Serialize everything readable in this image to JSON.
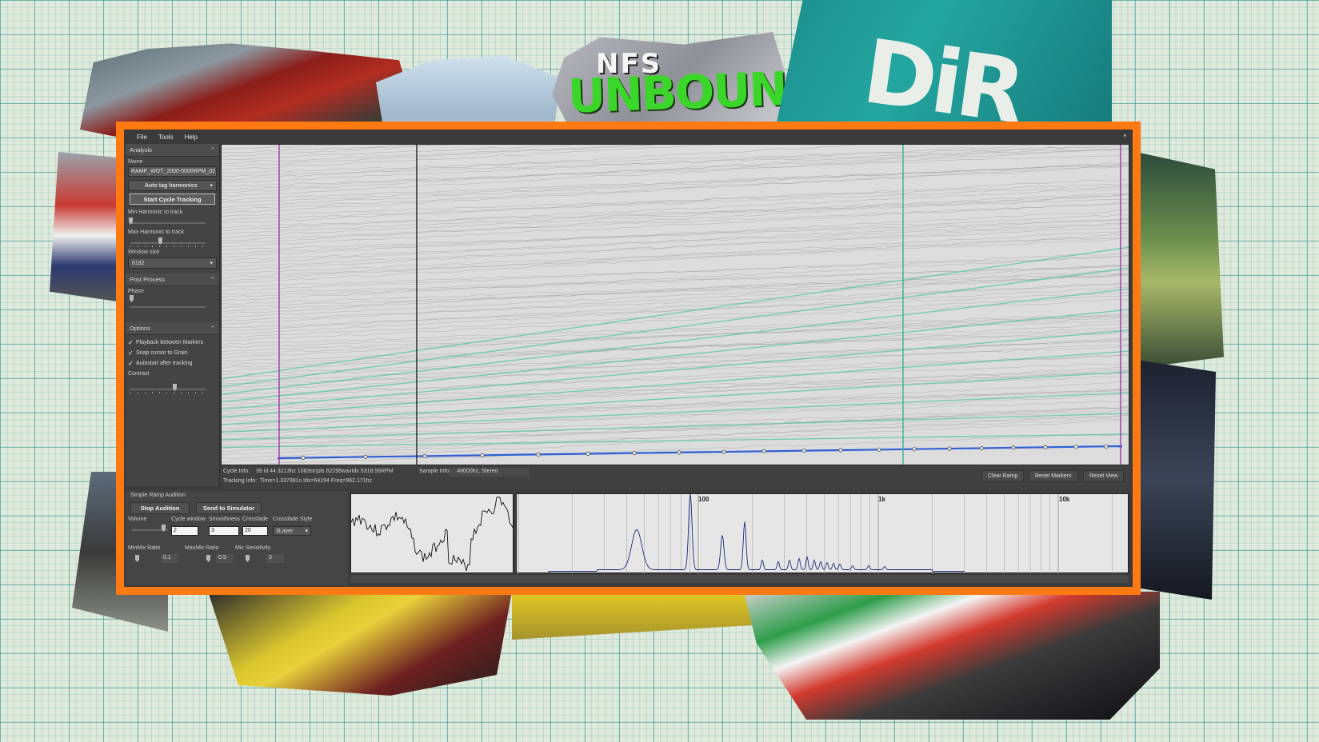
{
  "collage": {
    "logo_top": "NFS",
    "logo_main": "UNBOUND",
    "dirt_letters": "DiR"
  },
  "menu": [
    "File",
    "Tools",
    "Help"
  ],
  "analysis": {
    "header": "Analysis",
    "name_label": "Name",
    "name_value": "RAMP_WOT_2000-5000RPM_02_",
    "auto_tag": "Auto tag harmonics",
    "start_tracking": "Start Cycle Tracking",
    "min_harmonic_label": "Min Harmonic to track",
    "max_harmonic_label": "Max Harmonic to track",
    "window_size_label": "Window size",
    "window_size_value": "8192"
  },
  "post_process": {
    "header": "Post Process",
    "phase_label": "Phase"
  },
  "options": {
    "header": "Options",
    "playback_between_markers": "Playback between Markers",
    "snap_cursor": "Snap cursor to Grain",
    "autostart": "Autostart after tracking",
    "contrast_label": "Contrast"
  },
  "info": {
    "cycle_label": "Cycle Info:",
    "cycle_value": "39 id   44.3213hz  1083smpls  62295wavIdx  5318.56RPM",
    "sample_label": "Sample Info:",
    "sample_value": "48000hz, Stereo",
    "tracking_label": "Tracking Info:",
    "tracking_value": "Time=1.337381s Idx=64194 Freq=962.171hz",
    "clear_ramp": "Clear Ramp",
    "reset_markers": "Reset Markers",
    "reset_view": "Reset View"
  },
  "audition": {
    "title": "Simple Ramp Audition",
    "stop": "Stop Audition",
    "send": "Send to Simulator",
    "volume_label": "Volume",
    "cycle_window_label": "Cycle window",
    "cycle_window_value": "2",
    "smoothness_label": "Smoothness",
    "smoothness_value": "3",
    "crossfade_label": "Crossfade",
    "crossfade_value": "20",
    "crossfade_style_label": "Crossfade Style",
    "crossfade_style_value": "3Layer",
    "minmix_label": "MinMix Ratio",
    "minmix_value": "0.1",
    "maxmix_label": "MaxMix Ratio",
    "maxmix_value": "0.9",
    "mix_sens_label": "Mix Sensitivity",
    "mix_sens_value": "3"
  },
  "fft_labels": [
    "100",
    "1k",
    "10k"
  ],
  "colors": {
    "frame": "#ff7a12",
    "harmonic_line": "#56c7a2",
    "tracked_line": "#2f5fd6",
    "marker_purple": "#9b3aa6",
    "marker_teal": "#3fae95"
  }
}
